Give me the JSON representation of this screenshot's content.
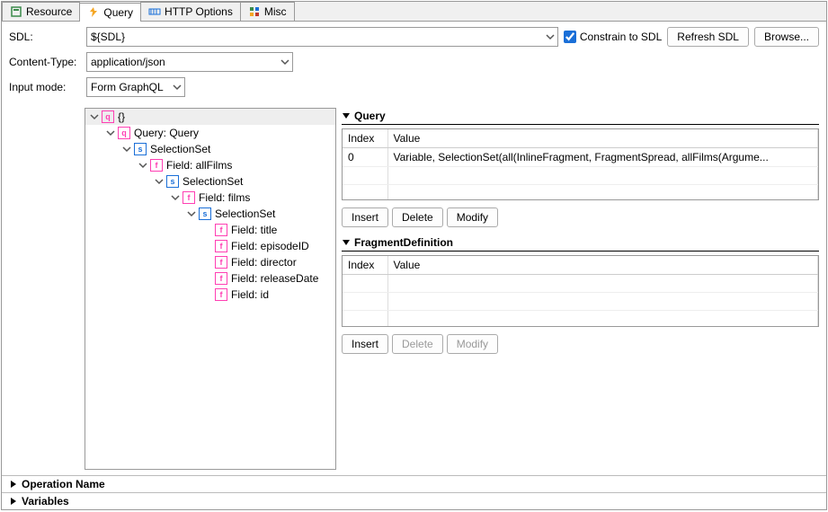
{
  "tabs": [
    {
      "label": "Resource"
    },
    {
      "label": "Query"
    },
    {
      "label": "HTTP Options"
    },
    {
      "label": "Misc"
    }
  ],
  "activeTabIndex": 1,
  "sdl": {
    "label": "SDL:",
    "value": "${SDL}",
    "constrain_label": "Constrain to SDL",
    "constrain_checked": true,
    "refresh_label": "Refresh SDL",
    "browse_label": "Browse..."
  },
  "content_type": {
    "label": "Content-Type:",
    "value": "application/json"
  },
  "input_mode": {
    "label": "Input mode:",
    "value": "Form GraphQL"
  },
  "tree": [
    {
      "depth": 0,
      "caret": "down",
      "badge": "q",
      "color": "#ff3fb3",
      "label": "{}",
      "root": true
    },
    {
      "depth": 1,
      "caret": "down",
      "badge": "q",
      "color": "#ff3fb3",
      "label": "Query: Query"
    },
    {
      "depth": 2,
      "caret": "down",
      "badge": "s",
      "color": "#1a6fd8",
      "label": "SelectionSet"
    },
    {
      "depth": 3,
      "caret": "down",
      "badge": "f",
      "color": "#ff3fb3",
      "label": "Field: allFilms"
    },
    {
      "depth": 4,
      "caret": "down",
      "badge": "s",
      "color": "#1a6fd8",
      "label": "SelectionSet"
    },
    {
      "depth": 5,
      "caret": "down",
      "badge": "f",
      "color": "#ff3fb3",
      "label": "Field: films"
    },
    {
      "depth": 6,
      "caret": "down",
      "badge": "s",
      "color": "#1a6fd8",
      "label": "SelectionSet"
    },
    {
      "depth": 7,
      "caret": "none",
      "badge": "f",
      "color": "#ff3fb3",
      "label": "Field: title"
    },
    {
      "depth": 7,
      "caret": "none",
      "badge": "f",
      "color": "#ff3fb3",
      "label": "Field: episodeID"
    },
    {
      "depth": 7,
      "caret": "none",
      "badge": "f",
      "color": "#ff3fb3",
      "label": "Field: director"
    },
    {
      "depth": 7,
      "caret": "none",
      "badge": "f",
      "color": "#ff3fb3",
      "label": "Field: releaseDate"
    },
    {
      "depth": 7,
      "caret": "none",
      "badge": "f",
      "color": "#ff3fb3",
      "label": "Field: id"
    }
  ],
  "query_section": {
    "title": "Query",
    "columns": [
      "Index",
      "Value"
    ],
    "rows": [
      {
        "index": "0",
        "value": "Variable, SelectionSet(all(InlineFragment, FragmentSpread, allFilms(Argume..."
      }
    ],
    "insert": "Insert",
    "delete": "Delete",
    "modify": "Modify",
    "delete_enabled": true,
    "modify_enabled": true
  },
  "fragment_section": {
    "title": "FragmentDefinition",
    "columns": [
      "Index",
      "Value"
    ],
    "rows": [],
    "insert": "Insert",
    "delete": "Delete",
    "modify": "Modify",
    "delete_enabled": false,
    "modify_enabled": false
  },
  "bottom": {
    "operation_name": "Operation Name",
    "variables": "Variables"
  }
}
